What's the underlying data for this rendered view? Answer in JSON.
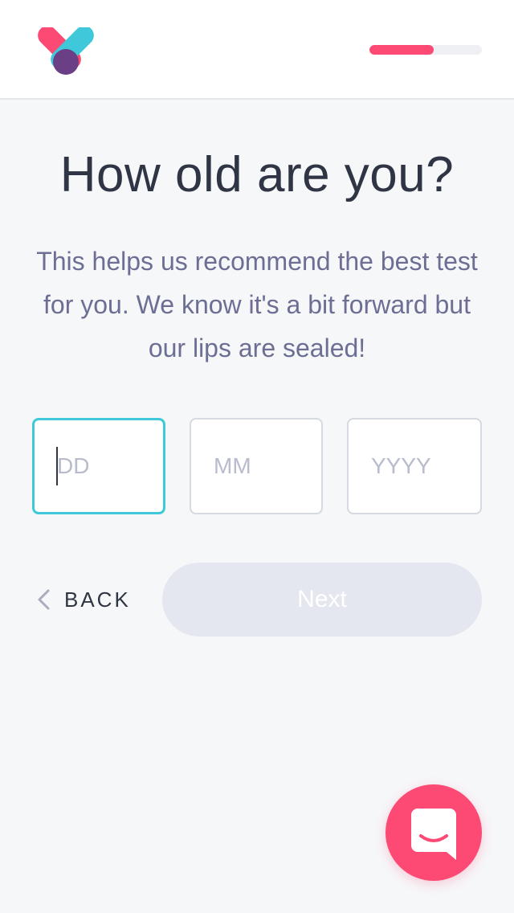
{
  "header": {
    "logo_icon": "heart-logo-icon",
    "progress_percent": 57,
    "colors": {
      "accent": "#fc4a74",
      "teal": "#3fc8d9",
      "purple": "#6b3f86"
    }
  },
  "main": {
    "title": "How old are you?",
    "subtitle": "This helps us recommend the best test for you. We know it's a bit forward but our lips are sealed!"
  },
  "form": {
    "day_placeholder": "DD",
    "month_placeholder": "MM",
    "year_placeholder": "YYYY",
    "day_value": "",
    "month_value": "",
    "year_value": ""
  },
  "actions": {
    "back_label": "BACK",
    "back_icon": "chevron-left-icon",
    "next_label": "Next"
  },
  "chat": {
    "icon": "chat-bubble-icon"
  }
}
